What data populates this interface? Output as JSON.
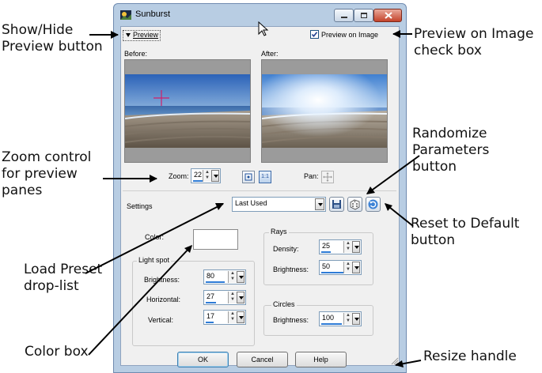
{
  "annotations": {
    "show_hide": "Show/Hide\nPreview button",
    "preview_on_image": "Preview on Image\ncheck box",
    "zoom": "Zoom control\nfor preview\npanes",
    "randomize": "Randomize\nParameters\nbutton",
    "reset": "Reset to Default\nbutton",
    "load_preset": "Load Preset\ndrop-list",
    "color_box": "Color box",
    "resize": "Resize handle"
  },
  "dialog": {
    "title": "Sunburst",
    "preview_toggle": "Preview",
    "preview_on_image_label": "Preview on Image",
    "preview_on_image_checked": true,
    "before_label": "Before:",
    "after_label": "After:",
    "zoom_label": "Zoom:",
    "zoom_value": "22",
    "zoom_one_to_one": "1:1",
    "pan_label": "Pan:",
    "settings_label": "Settings",
    "preset_value": "Last Used",
    "color_label": "Color:",
    "light_spot": {
      "title": "Light spot",
      "brightness_label": "Brightness:",
      "brightness": "80",
      "horizontal_label": "Horizontal:",
      "horizontal": "27",
      "vertical_label": "Vertical:",
      "vertical": "17"
    },
    "rays": {
      "title": "Rays",
      "density_label": "Density:",
      "density": "25",
      "brightness_label": "Brightness:",
      "brightness": "50"
    },
    "circles": {
      "title": "Circles",
      "brightness_label": "Brightness:",
      "brightness": "100"
    },
    "ok": "OK",
    "cancel": "Cancel",
    "help": "Help"
  },
  "colors": {
    "accent": "#2e7bd6",
    "titlebar": "#b8cde3",
    "close_button": "#c4432b",
    "crosshair": "#d0206a"
  }
}
